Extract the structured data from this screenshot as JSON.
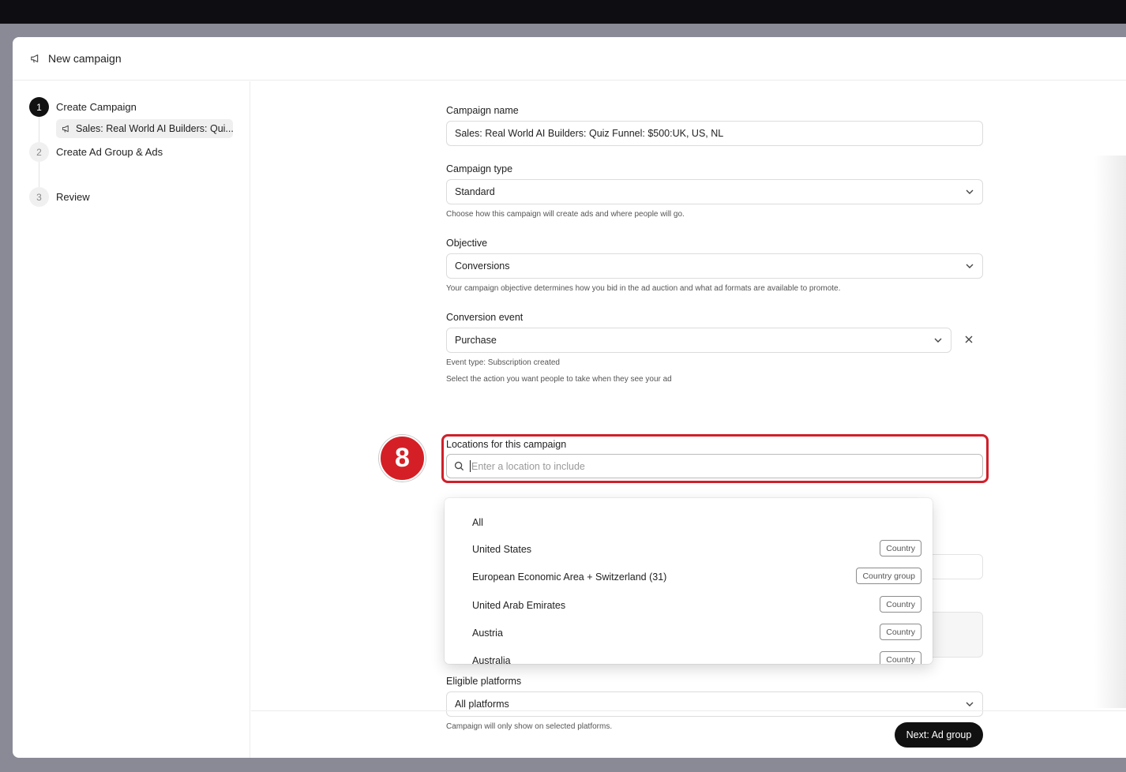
{
  "window": {
    "title": "New campaign"
  },
  "steps": [
    {
      "num": "1",
      "label": "Create Campaign"
    },
    {
      "num": "2",
      "label": "Create Ad Group & Ads"
    },
    {
      "num": "3",
      "label": "Review"
    }
  ],
  "substep": {
    "label": "Sales: Real World AI Builders: Qui..."
  },
  "form": {
    "campaign_name": {
      "label": "Campaign name",
      "value": "Sales: Real World AI Builders: Quiz Funnel: $500:UK, US, NL"
    },
    "campaign_type": {
      "label": "Campaign type",
      "value": "Standard",
      "help": "Choose how this campaign will create ads and where people will go."
    },
    "objective": {
      "label": "Objective",
      "value": "Conversions",
      "help": "Your campaign objective determines how you bid in the ad auction and what ad formats are available to promote."
    },
    "conversion_event": {
      "label": "Conversion event",
      "value": "Purchase",
      "help_type": "Event type: Subscription created",
      "help": "Select the action you want people to take when they see your ad"
    },
    "locations": {
      "label": "Locations for this campaign",
      "placeholder": "Enter a location to include"
    },
    "platforms": {
      "label": "Eligible platforms",
      "value": "All platforms",
      "help": "Campaign will only show on selected platforms."
    }
  },
  "dropdown": {
    "options": [
      {
        "label": "All",
        "tag": ""
      },
      {
        "label": "United States",
        "tag": "Country"
      },
      {
        "label": "European Economic Area + Switzerland (31)",
        "tag": "Country group"
      },
      {
        "label": "United Arab Emirates",
        "tag": "Country"
      },
      {
        "label": "Austria",
        "tag": "Country"
      },
      {
        "label": "Australia",
        "tag": "Country"
      }
    ]
  },
  "annotation": {
    "step_badge": "8",
    "color": "#d51f26"
  },
  "footer": {
    "next_label": "Next: Ad group"
  }
}
